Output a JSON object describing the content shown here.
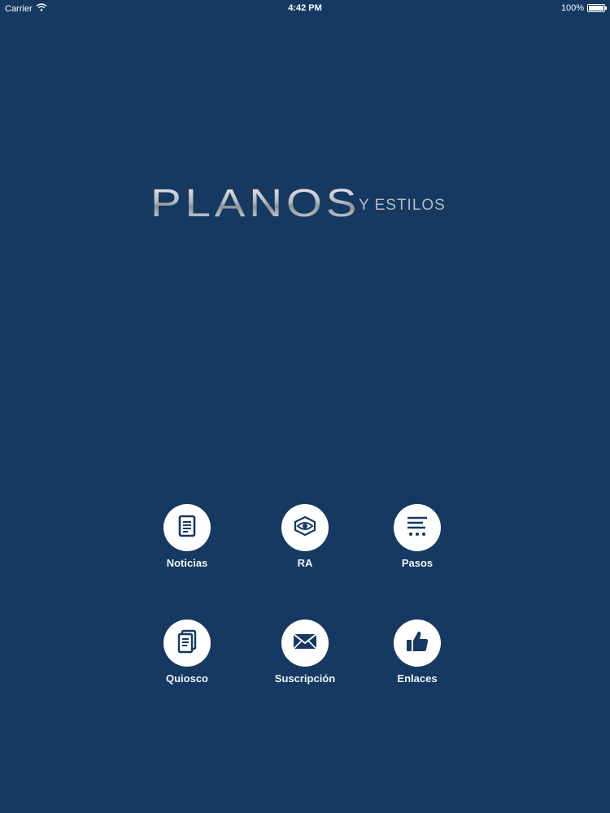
{
  "status_bar": {
    "carrier": "Carrier",
    "time": "4:42 PM",
    "battery": "100%",
    "battery_level": 1.0
  },
  "logo": {
    "main": "PLANOS",
    "sub": "Y ESTILOS"
  },
  "menu": [
    {
      "label": "Noticias",
      "icon": "document-icon"
    },
    {
      "label": "RA",
      "icon": "eye-icon"
    },
    {
      "label": "Pasos",
      "icon": "steps-list-icon"
    },
    {
      "label": "Quiosco",
      "icon": "magazine-icon"
    },
    {
      "label": "Suscripción",
      "icon": "envelope-icon"
    },
    {
      "label": "Enlaces",
      "icon": "thumbs-up-icon"
    }
  ],
  "colors": {
    "background": "#153961",
    "icon": "#153961",
    "circle": "#ffffff"
  }
}
